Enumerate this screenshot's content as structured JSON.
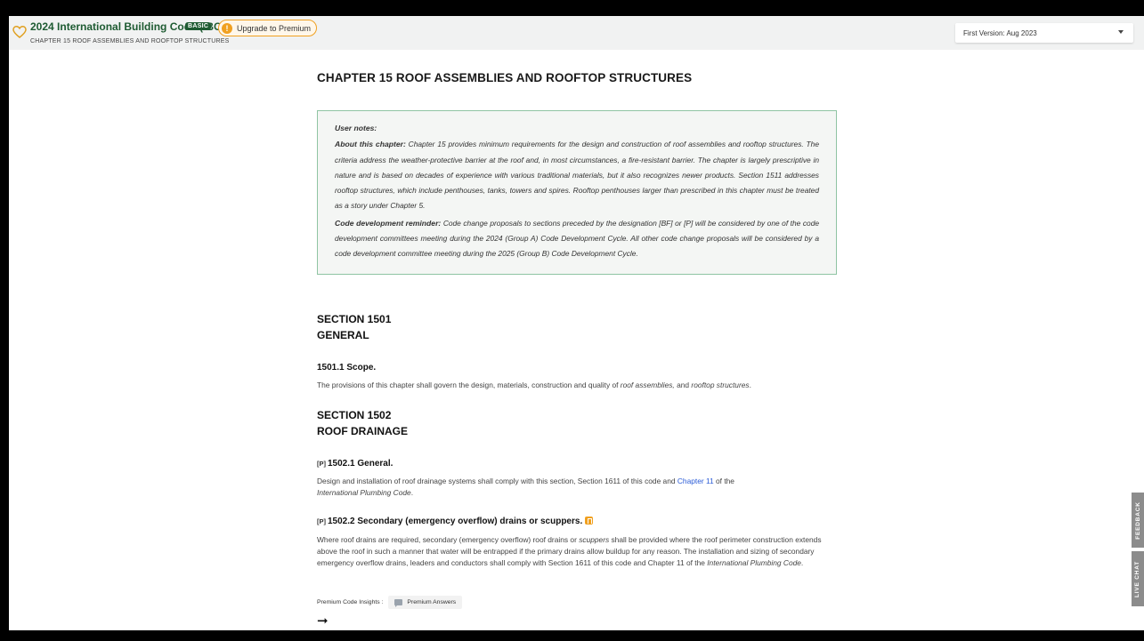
{
  "header": {
    "title": "2024 International Building Code (IBC)",
    "badge": "BASIC",
    "upgrade_label": "Upgrade to Premium",
    "upgrade_icon": "!",
    "breadcrumb": "CHAPTER 15 ROOF ASSEMBLIES AND ROOFTOP STRUCTURES",
    "version_label": "First Version: Aug 2023"
  },
  "content": {
    "chapter_title": "CHAPTER 15  ROOF ASSEMBLIES AND ROOFTOP STRUCTURES",
    "notes": {
      "heading": "User notes:",
      "about_label": "About this chapter:",
      "about_text": " Chapter 15 provides minimum requirements for the design and construction of roof assemblies and rooftop structures. The criteria address the weather-protective barrier at the roof and, in most circumstances, a fire-resistant barrier. The chapter is largely prescriptive in nature and is based on decades of experience with various traditional materials, but it also recognizes newer products. Section 1511 addresses rooftop structures, which include penthouses, tanks, towers and spires. Rooftop penthouses larger than prescribed in this chapter must be treated as a story under Chapter 5.",
      "reminder_label": "Code development reminder:",
      "reminder_text": " Code change proposals to sections preceded by the designation [BF] or [P] will be considered by one of the code development committees meeting during the 2024 (Group A) Code Development Cycle. All other code change proposals will be considered by a code development committee meeting during the 2025 (Group B) Code Development Cycle."
    },
    "section_1501": {
      "number": "SECTION 1501",
      "name": "GENERAL",
      "scope_title": "1501.1 Scope.",
      "scope_text_1": "The provisions of this chapter shall govern the design, materials, construction and quality of ",
      "scope_em_1": "roof assemblies,",
      "scope_text_2": " and ",
      "scope_em_2": "rooftop structures",
      "scope_text_3": "."
    },
    "section_1502": {
      "number": "SECTION 1502",
      "name": "ROOF DRAINAGE",
      "general_tag": "[P]",
      "general_title": "1502.1 General.",
      "general_text_1": "Design and installation of roof drainage systems shall comply with this section, Section 1611 of this code and ",
      "general_link": "Chapter 11",
      "general_text_2": " of the ",
      "general_em": "International Plumbing Code",
      "general_text_3": ".",
      "secondary_tag": "[P]",
      "secondary_title": "1502.2 Secondary (emergency overflow) drains or scuppers.",
      "secondary_text_1": "Where roof drains are required, secondary (emergency overflow) roof drains or ",
      "secondary_em_1": "scuppers",
      "secondary_text_2": " shall be provided where the roof perimeter construction extends above the roof in such a manner that water will be entrapped if the primary drains allow buildup for any reason. The installation and sizing of secondary emergency overflow drains, leaders and conductors shall comply with Section 1611 of this code and Chapter 11 of the ",
      "secondary_em_2": "International Plumbing Code",
      "secondary_text_3": "."
    },
    "insights_label": "Premium Code Insights :",
    "premium_answers_label": "Premium Answers",
    "next_arrow": "➞"
  },
  "side_tabs": {
    "feedback": "FEEDBACK",
    "live_chat": "LIVE CHAT"
  }
}
